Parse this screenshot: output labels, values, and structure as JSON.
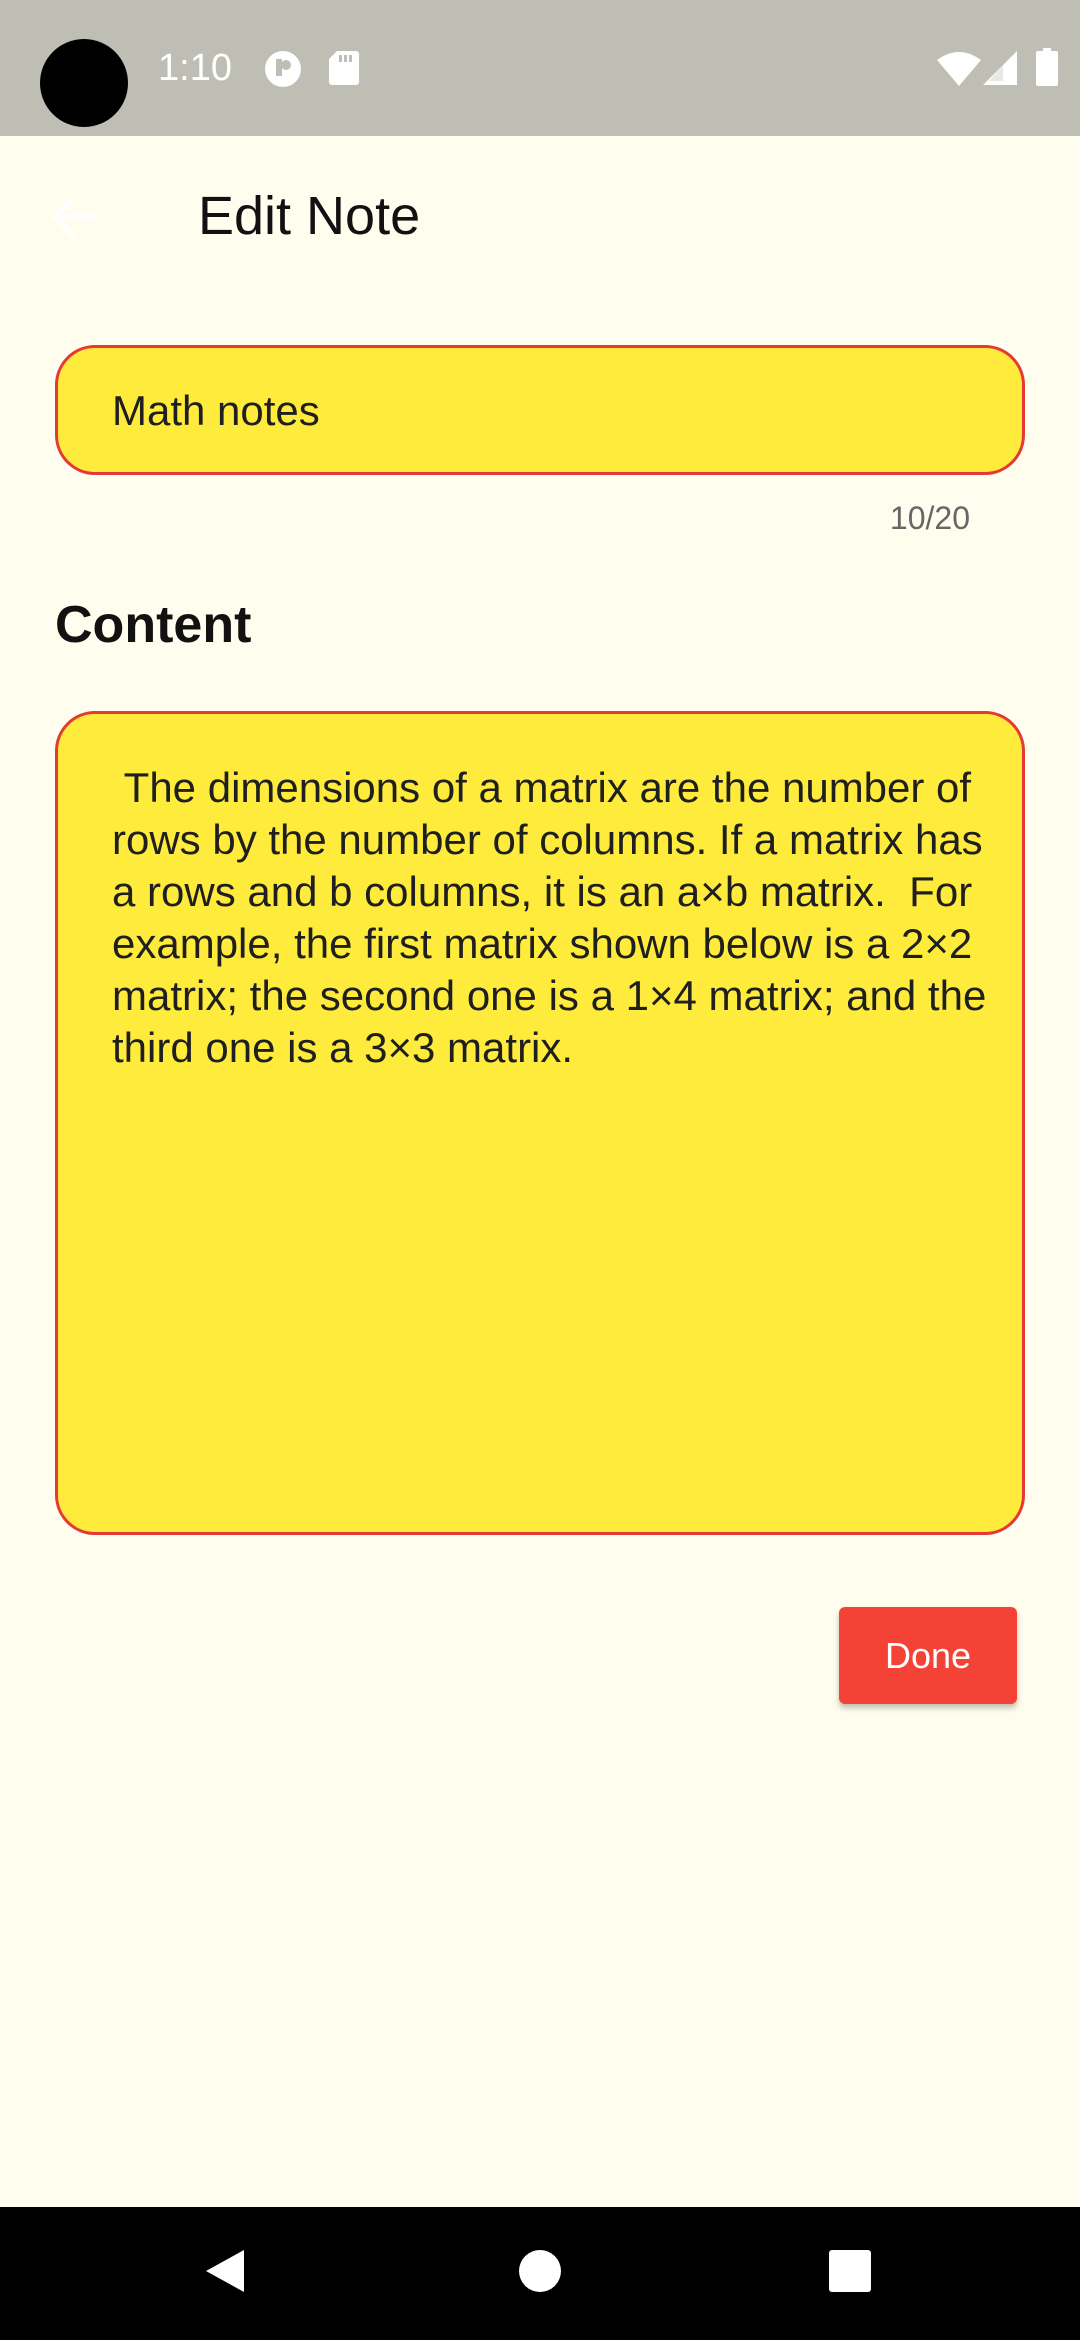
{
  "status_bar": {
    "time": "1:10",
    "icons": [
      "notification-app-icon",
      "sd-card-icon",
      "wifi-icon",
      "cell-signal-icon",
      "battery-icon"
    ],
    "background": "#BEBEB4"
  },
  "app_bar": {
    "title": "Edit Note",
    "back_icon": "back-arrow-icon"
  },
  "title_field": {
    "value": "Math notes",
    "counter": "10/20",
    "fill_color": "#FFEB3B",
    "border_color": "#E53935"
  },
  "content_section": {
    "label": "Content",
    "value": " The dimensions of a matrix are the number of rows by the number of columns. If a matrix has a rows and b columns, it is an a×b matrix.  For example, the first matrix shown below is a 2×2 matrix; the second one is a 1×4 matrix; and the third one is a 3×3 matrix."
  },
  "actions": {
    "done_label": "Done",
    "done_color": "#F44336"
  },
  "navigation_bar": {
    "items": [
      "back-triangle-icon",
      "home-circle-icon",
      "recents-square-icon"
    ]
  },
  "colors": {
    "background": "#FFFDEE",
    "accent": "#F44336",
    "field": "#FFEB3B"
  }
}
